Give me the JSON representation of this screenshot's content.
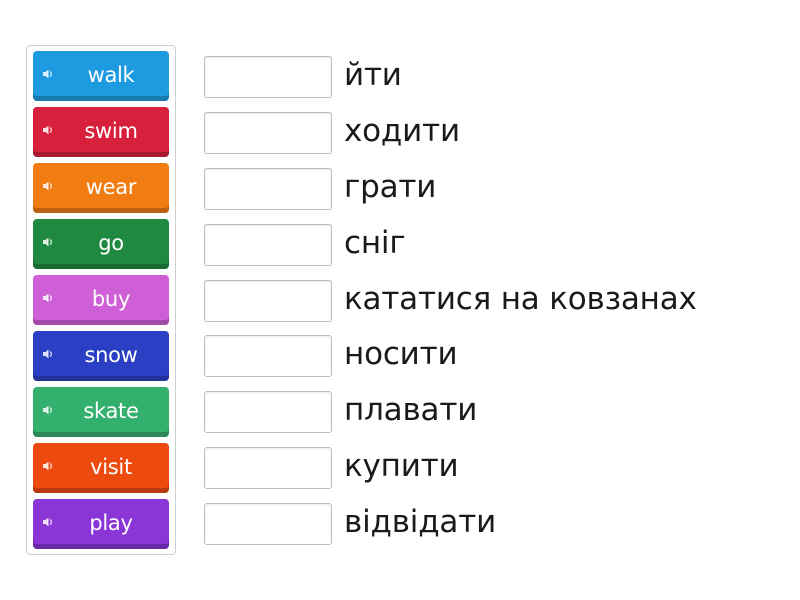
{
  "tiles": [
    {
      "label": "walk",
      "color": "#1e9be0"
    },
    {
      "label": "swim",
      "color": "#d6203c"
    },
    {
      "label": "wear",
      "color": "#f07c12"
    },
    {
      "label": "go",
      "color": "#1f8a3f"
    },
    {
      "label": "buy",
      "color": "#cf5fd6"
    },
    {
      "label": "snow",
      "color": "#2b3fc4"
    },
    {
      "label": "skate",
      "color": "#34b06e"
    },
    {
      "label": "visit",
      "color": "#ec4a0f"
    },
    {
      "label": "play",
      "color": "#8a35d6"
    }
  ],
  "clues": [
    {
      "text": "йти"
    },
    {
      "text": "ходити"
    },
    {
      "text": "грати"
    },
    {
      "text": "сніг"
    },
    {
      "text": "кататися на ковзанах"
    },
    {
      "text": "носити"
    },
    {
      "text": "плавати"
    },
    {
      "text": "купити"
    },
    {
      "text": "відвідати"
    }
  ],
  "speaker_icon": "speaker-icon"
}
